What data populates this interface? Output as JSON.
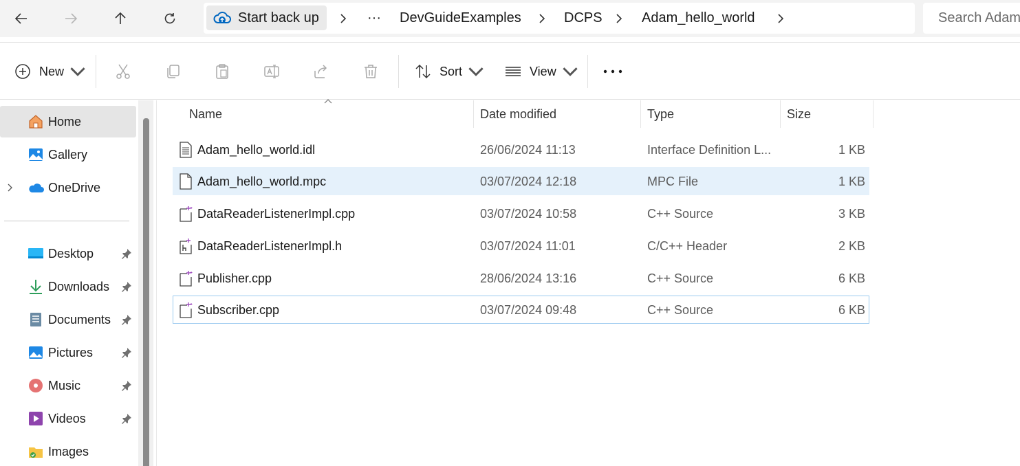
{
  "address_bar": {
    "home_crumb": "Start back up",
    "overflow": "···",
    "crumbs": [
      "DevGuideExamples",
      "DCPS",
      "Adam_hello_world"
    ],
    "search_placeholder": "Search Adam_hello_world"
  },
  "command_bar": {
    "new_label": "New",
    "sort_label": "Sort",
    "view_label": "View",
    "more_label": "···"
  },
  "sidebar": {
    "items": [
      {
        "label": "Home",
        "icon": "home-icon",
        "active": true
      },
      {
        "label": "Gallery",
        "icon": "gallery-icon"
      },
      {
        "label": "OneDrive",
        "icon": "onedrive-icon"
      },
      {
        "label": "Desktop",
        "icon": "desktop-icon",
        "pinned": true
      },
      {
        "label": "Downloads",
        "icon": "downloads-icon",
        "pinned": true
      },
      {
        "label": "Documents",
        "icon": "documents-icon",
        "pinned": true
      },
      {
        "label": "Pictures",
        "icon": "pictures-icon",
        "pinned": true
      },
      {
        "label": "Music",
        "icon": "music-icon",
        "pinned": true
      },
      {
        "label": "Videos",
        "icon": "videos-icon",
        "pinned": true
      },
      {
        "label": "Images",
        "icon": "folder-icon"
      }
    ]
  },
  "file_list": {
    "columns": [
      "Name",
      "Date modified",
      "Type",
      "Size"
    ],
    "sorted_by": "Name",
    "rows": [
      {
        "name": "Adam_hello_world.idl",
        "date": "26/06/2024 11:13",
        "type": "Interface Definition L...",
        "size": "1 KB",
        "icon": "document-icon"
      },
      {
        "name": "Adam_hello_world.mpc",
        "date": "03/07/2024 12:18",
        "type": "MPC File",
        "size": "1 KB",
        "icon": "blank-file-icon",
        "selected": true
      },
      {
        "name": "DataReaderListenerImpl.cpp",
        "date": "03/07/2024 10:58",
        "type": "C++ Source",
        "size": "3 KB",
        "icon": "cpp-file-icon"
      },
      {
        "name": "DataReaderListenerImpl.h",
        "date": "03/07/2024 11:01",
        "type": "C/C++ Header",
        "size": "2 KB",
        "icon": "header-file-icon"
      },
      {
        "name": "Publisher.cpp",
        "date": "28/06/2024 13:16",
        "type": "C++ Source",
        "size": "6 KB",
        "icon": "cpp-file-icon"
      },
      {
        "name": "Subscriber.cpp",
        "date": "03/07/2024 09:48",
        "type": "C++ Source",
        "size": "6 KB",
        "icon": "cpp-file-icon",
        "focused": true
      }
    ]
  },
  "colors": {
    "selection": "#e5f1fb",
    "focus_border": "#99c9ef",
    "accent": "#0067c0"
  }
}
